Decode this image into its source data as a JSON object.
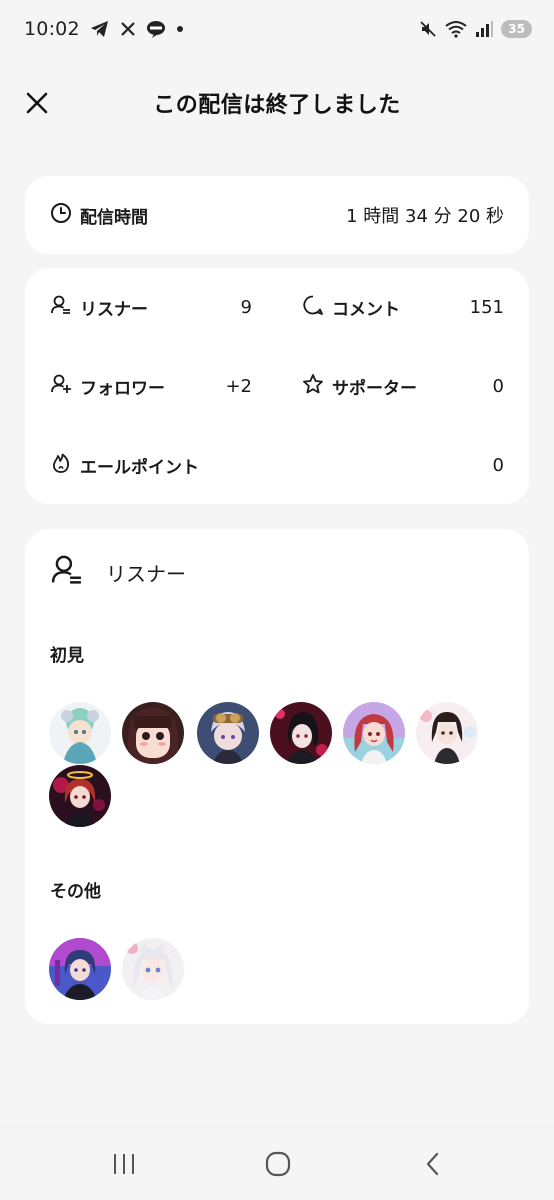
{
  "status_bar": {
    "time": "10:02",
    "battery": "35",
    "icons_left": [
      "telegram-icon",
      "x-icon",
      "line-icon",
      "dot-icon"
    ],
    "icons_right": [
      "mute-icon",
      "wifi-icon",
      "signal-icon",
      "battery-icon"
    ]
  },
  "header": {
    "title": "この配信は終了しました"
  },
  "duration": {
    "label": "配信時間",
    "value": "1 時間 34 分 20 秒"
  },
  "stats": {
    "listeners_label": "リスナー",
    "listeners_value": "9",
    "comments_label": "コメント",
    "comments_value": "151",
    "followers_label": "フォロワー",
    "followers_value": "+2",
    "supporters_label": "サポーター",
    "supporters_value": "0",
    "yell_label": "エールポイント",
    "yell_value": "0"
  },
  "listeners": {
    "title": "リスナー",
    "first_time_label": "初見",
    "others_label": "その他",
    "first_time_count": 7,
    "others_count": 2
  },
  "colors": {
    "background": "#f5f5f5",
    "card": "#ffffff",
    "text": "#1a1a1a"
  }
}
